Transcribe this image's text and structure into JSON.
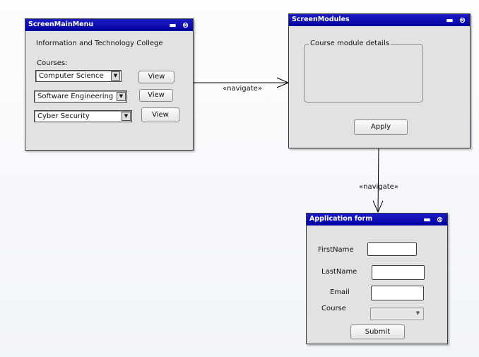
{
  "diagram": {
    "edges": [
      {
        "from": "ScreenMainMenu",
        "to": "ScreenModules",
        "label": "«navigate»"
      },
      {
        "from": "ScreenModules",
        "to": "Application form",
        "label": "«navigate»"
      }
    ]
  },
  "main_menu": {
    "title": "ScreenMainMenu",
    "college_name": "Information and Technology College",
    "courses_label": "Courses:",
    "course_rows": [
      {
        "course": "Computer Science",
        "button": "View"
      },
      {
        "course": "Software Engineering",
        "button": "View"
      },
      {
        "course": "Cyber Security",
        "button": "View"
      }
    ]
  },
  "modules": {
    "title": "ScreenModules",
    "group_label": "Course module details",
    "apply_button": "Apply"
  },
  "application_form": {
    "title": "Application form",
    "first_name_label": "FirstName",
    "first_name_value": "",
    "last_name_label": "LastName",
    "last_name_value": "",
    "email_label": "Email",
    "email_value": "",
    "course_label": "Course",
    "course_value": "",
    "submit_button": "Submit"
  },
  "icons": {
    "minimize": "minimize-icon",
    "close": "close-icon",
    "dropdown": "dropdown-arrow-icon"
  },
  "colors": {
    "titlebar": "#0000a0",
    "window_body": "#e2e2e2",
    "connector": "#000000"
  }
}
